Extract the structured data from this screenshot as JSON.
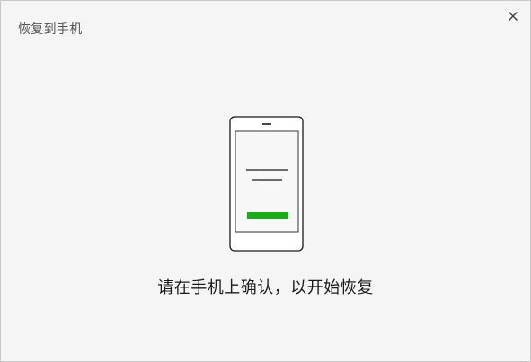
{
  "window": {
    "title": "恢复到手机",
    "close_icon": "close-icon"
  },
  "main": {
    "illustration_icon": "phone-confirm-icon",
    "message": "请在手机上确认，以开始恢复"
  },
  "colors": {
    "background": "#f5f5f5",
    "accent": "#1aad19",
    "text": "#1a1a1a",
    "title_text": "#555555"
  }
}
